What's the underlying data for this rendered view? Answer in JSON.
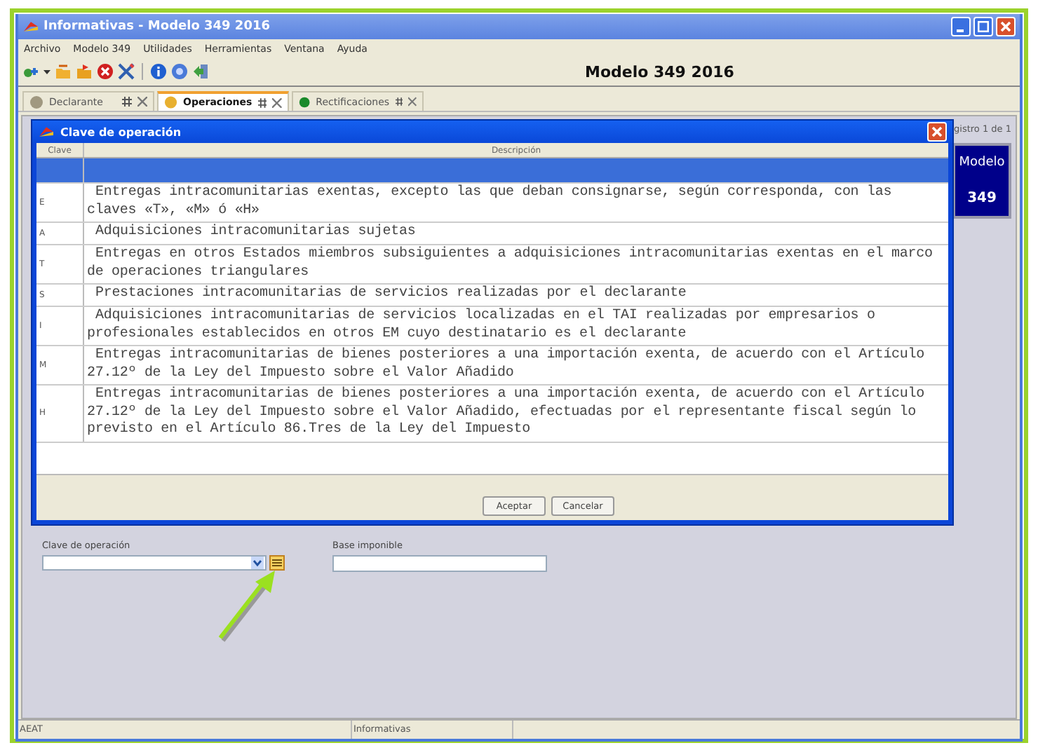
{
  "window": {
    "title": "Informativas - Modelo 349 2016"
  },
  "menu": [
    "Archivo",
    "Modelo 349",
    "Utilidades",
    "Herramientas",
    "Ventana",
    "Ayuda"
  ],
  "heading": "Modelo 349 2016",
  "tabs": [
    {
      "label": "Declarante",
      "selected": false
    },
    {
      "label": "Operaciones",
      "selected": true
    },
    {
      "label": "Rectificaciones",
      "selected": false
    }
  ],
  "record_counter": "gistro 1 de 1",
  "model_badge": {
    "line_1": "Modelo",
    "line_2": "349"
  },
  "dialog": {
    "title": "Clave de operación",
    "table": {
      "columns": [
        "Clave",
        "Descripción"
      ],
      "rows": [
        {
          "selected": true
        },
        {
          "clave": "E",
          "description": "Entregas intracomunitarias exentas, excepto las que deban consignarse, según corresponda, con las claves «T», «M» ó «H»",
          "selected": false
        },
        {
          "clave": "A",
          "description": "Adquisiciones intracomunitarias sujetas",
          "selected": false
        },
        {
          "clave": "T",
          "description": "Entregas en otros Estados miembros subsiguientes a adquisiciones intracomunitarias exentas en el marco de operaciones triangulares",
          "selected": false
        },
        {
          "clave": "S",
          "description": "Prestaciones intracomunitarias de servicios realizadas por el declarante",
          "selected": false
        },
        {
          "clave": "I",
          "description": "Adquisiciones intracomunitarias de servicios localizadas en el TAI realizadas por empresarios o profesionales establecidos en otros EM cuyo destinatario es el declarante",
          "selected": false
        },
        {
          "clave": "M",
          "description": "Entregas intracomunitarias de bienes posteriores a una importación exenta, de acuerdo con el Artículo 27.12º de la Ley del Impuesto sobre el Valor Añadido",
          "selected": false
        },
        {
          "clave": "H",
          "description": "Entregas intracomunitarias de bienes posteriores a una importación exenta, de acuerdo con el Artículo 27.12º de la Ley del Impuesto sobre el Valor Añadido, efectuadas por el representante fiscal según lo previsto en el Artículo 86.Tres de la Ley del Impuesto",
          "selected": false
        }
      ]
    },
    "buttons": [
      "Aceptar",
      "Cancelar"
    ]
  },
  "form": {
    "fields": [
      {
        "label": "Clave de operación",
        "kind": "combo"
      },
      {
        "label": "Base imponible",
        "kind": "text"
      }
    ]
  },
  "status_bar": [
    "AEAT",
    "Informativas"
  ]
}
